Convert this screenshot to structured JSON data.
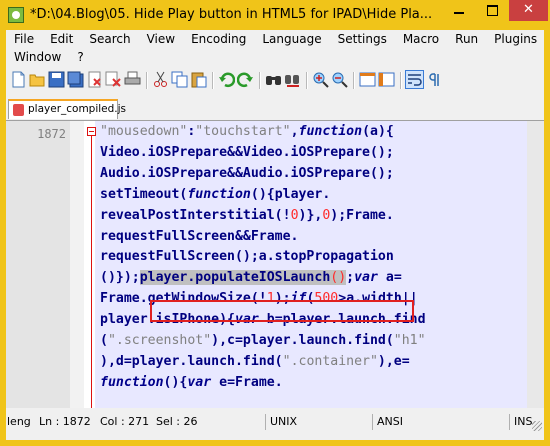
{
  "window": {
    "title": "*D:\\04.Blog\\05. Hide Play button in HTML5 for IPAD\\Hide Pla...",
    "min_glyph": "",
    "max_glyph": "",
    "close_glyph": "✕"
  },
  "menu": {
    "row1": [
      "File",
      "Edit",
      "Search",
      "View",
      "Encoding",
      "Language",
      "Settings",
      "Macro",
      "Run",
      "Plugins"
    ],
    "row2": [
      "Window",
      "?"
    ]
  },
  "toolbar": {
    "icons": [
      "new-file-icon",
      "open-folder-icon",
      "save-icon",
      "save-all-icon",
      "close-file-icon",
      "close-all-icon",
      "print-icon",
      "cut-icon",
      "copy-icon",
      "paste-icon",
      "undo-icon",
      "redo-icon",
      "find-icon",
      "replace-icon",
      "zoom-in-icon",
      "zoom-out-icon",
      "sync-vertical-icon",
      "sync-horizontal-icon",
      "word-wrap-icon",
      "show-all-chars-icon"
    ]
  },
  "tab": {
    "label": "player_compiled.js"
  },
  "editor": {
    "line_number": "1872",
    "lines": [
      [
        {
          "t": "\"mousedown\"",
          "c": "s"
        },
        {
          "t": ":",
          "c": "o"
        },
        {
          "t": "\"touchstart\"",
          "c": "s"
        },
        {
          "t": ",",
          "c": "o"
        },
        {
          "t": "function",
          "c": "k"
        },
        {
          "t": "(a){",
          "c": "o"
        }
      ],
      [
        {
          "t": "Video.iOSPrepare&&Video.iOSPrepare();",
          "c": "o"
        }
      ],
      [
        {
          "t": "Audio.iOSPrepare&&Audio.iOSPrepare();",
          "c": "o"
        }
      ],
      [
        {
          "t": "setTimeout(",
          "c": "o"
        },
        {
          "t": "function",
          "c": "k"
        },
        {
          "t": "(){player.",
          "c": "o"
        }
      ],
      [
        {
          "t": "revealPostInterstitial(!",
          "c": "o"
        },
        {
          "t": "0",
          "c": "n"
        },
        {
          "t": ")},",
          "c": "o"
        },
        {
          "t": "0",
          "c": "n"
        },
        {
          "t": ");Frame.",
          "c": "o"
        }
      ],
      [
        {
          "t": "requestFullScreen&&Frame.",
          "c": "o"
        }
      ],
      [
        {
          "t": "requestFullScreen();a.stopPropagation",
          "c": "o"
        }
      ],
      [
        {
          "t": "()});",
          "c": "o"
        },
        {
          "t": "player.populateIOSLaunch",
          "c": "o hl"
        },
        {
          "t": "()",
          "c": "n hl"
        },
        {
          "t": ";",
          "c": "o"
        },
        {
          "t": "var",
          "c": "k"
        },
        {
          "t": " a=",
          "c": "o"
        }
      ],
      [
        {
          "t": "Frame.getWindowSize(!",
          "c": "o"
        },
        {
          "t": "1",
          "c": "n"
        },
        {
          "t": ");",
          "c": "o"
        },
        {
          "t": "if",
          "c": "k"
        },
        {
          "t": "(",
          "c": "o"
        },
        {
          "t": "500",
          "c": "n"
        },
        {
          "t": ">a.width||",
          "c": "o"
        }
      ],
      [
        {
          "t": "player.isIPhone){",
          "c": "o"
        },
        {
          "t": "var",
          "c": "k"
        },
        {
          "t": " b=player.launch.find",
          "c": "o"
        }
      ],
      [
        {
          "t": "(",
          "c": "o"
        },
        {
          "t": "\".screenshot\"",
          "c": "s"
        },
        {
          "t": "),c=player.launch.find(",
          "c": "o"
        },
        {
          "t": "\"h1\"",
          "c": "s"
        }
      ],
      [
        {
          "t": "),d=player.launch.find(",
          "c": "o"
        },
        {
          "t": "\".container\"",
          "c": "s"
        },
        {
          "t": "),e=",
          "c": "o"
        }
      ],
      [
        {
          "t": "function",
          "c": "k"
        },
        {
          "t": "(){",
          "c": "o"
        },
        {
          "t": "var",
          "c": "k"
        },
        {
          "t": " e=Frame.",
          "c": "o"
        }
      ]
    ]
  },
  "status": {
    "length": "lengt",
    "ln": "Ln : 1872",
    "col": "Col : 271",
    "sel": "Sel : 26",
    "eol": "UNIX",
    "encoding": "ANSI",
    "mode": "INS"
  }
}
